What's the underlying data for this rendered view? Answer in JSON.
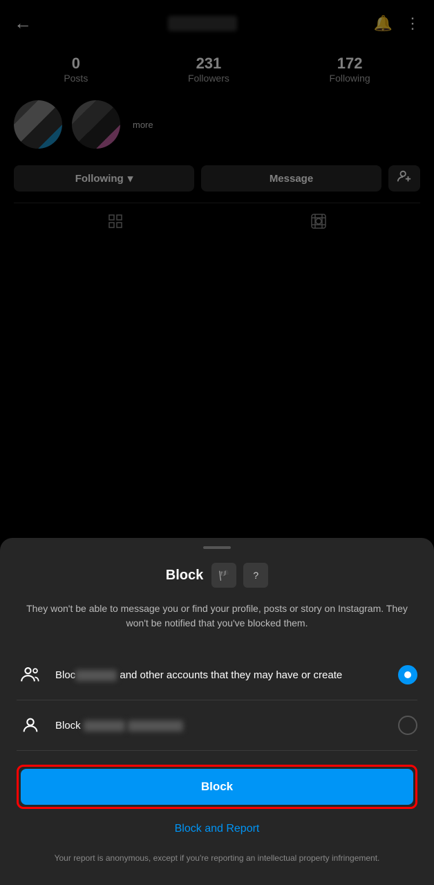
{
  "header": {
    "back_label": "←",
    "bell_icon": "🔔",
    "dots_icon": "⋮"
  },
  "profile": {
    "stats": [
      {
        "id": "posts",
        "number": "0",
        "label": "Posts"
      },
      {
        "id": "followers",
        "number": "231",
        "label": "Followers"
      },
      {
        "id": "following",
        "number": "172",
        "label": "Following"
      }
    ],
    "highlights_more": "more"
  },
  "actions": {
    "following_label": "Following",
    "message_label": "Message",
    "dropdown_icon": "▾",
    "add_icon": "+"
  },
  "sheet": {
    "handle": "",
    "title": "Block",
    "description": "They won't be able to message you or find your profile, posts or story on Instagram. They won't be notified that you've blocked them.",
    "option1_text": " and other accounts that they may have or create",
    "option2_prefix": "Block",
    "block_button_label": "Block",
    "block_report_label": "Block and Report",
    "report_note": "Your report is anonymous, except if you're reporting an intellectual property infringement."
  }
}
